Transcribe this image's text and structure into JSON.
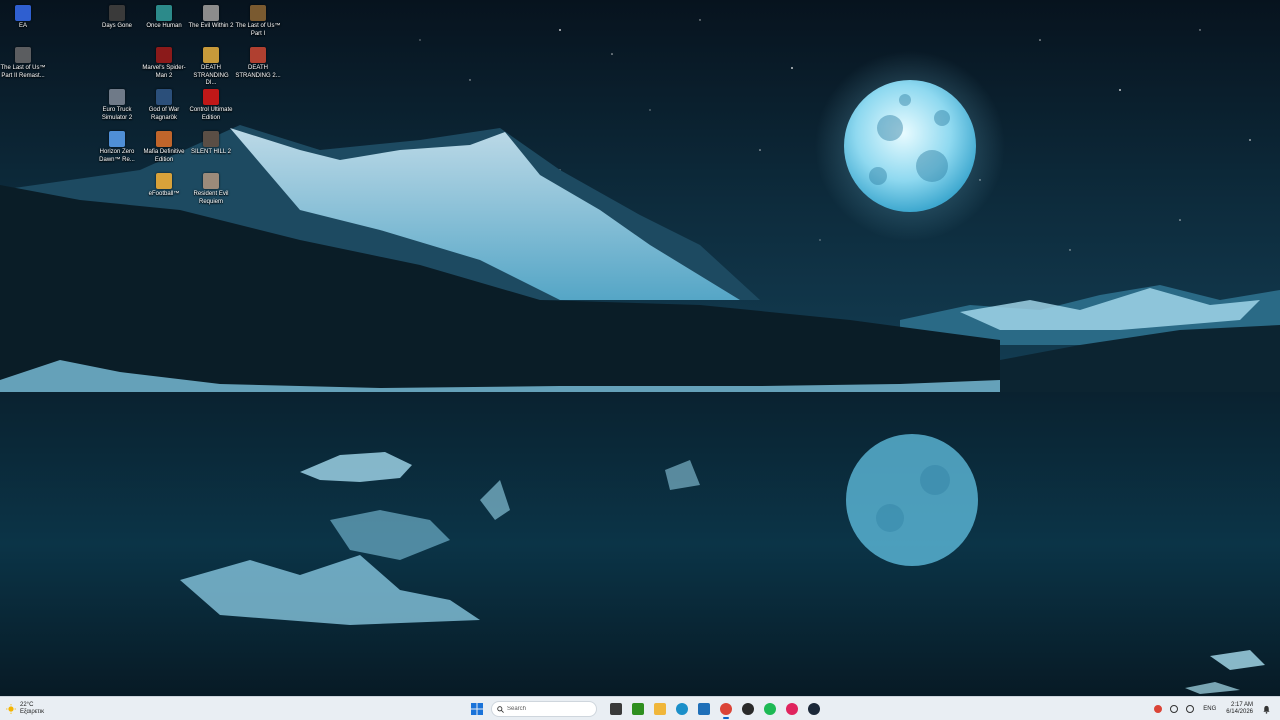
{
  "desktop": {
    "icons": [
      {
        "name": "desktop-icon-ea",
        "label": "EA",
        "icon": "ea-icon",
        "color": "#2f5fd0",
        "col": 0,
        "row": 0
      },
      {
        "name": "desktop-icon-last-of-us-2",
        "label": "The Last of Us™ Part II Remast...",
        "icon": "last-of-us-2-icon",
        "color": "#5b5d60",
        "col": 0,
        "row": 1
      },
      {
        "name": "desktop-icon-days-gone",
        "label": "Days Gone",
        "icon": "days-gone-icon",
        "color": "#3a3a3a",
        "col": 2,
        "row": 0
      },
      {
        "name": "desktop-icon-euro-truck",
        "label": "Euro Truck Simulator 2",
        "icon": "euro-truck-icon",
        "color": "#6f7a88",
        "col": 2,
        "row": 2
      },
      {
        "name": "desktop-icon-horizon-zero-dawn",
        "label": "Horizon Zero Dawn™ Re...",
        "icon": "horizon-zero-dawn-icon",
        "color": "#4f8fd6",
        "col": 2,
        "row": 3
      },
      {
        "name": "desktop-icon-once-human",
        "label": "Once Human",
        "icon": "once-human-icon",
        "color": "#2c8a8a",
        "col": 3,
        "row": 0
      },
      {
        "name": "desktop-icon-spider-man-2",
        "label": "Marvel's Spider-Man 2",
        "icon": "spider-man-icon",
        "color": "#8b1a1a",
        "col": 3,
        "row": 1
      },
      {
        "name": "desktop-icon-god-of-war",
        "label": "God of War Ragnarök",
        "icon": "god-of-war-icon",
        "color": "#2b4f7a",
        "col": 3,
        "row": 2
      },
      {
        "name": "desktop-icon-mafia",
        "label": "Mafia Definitive Edition",
        "icon": "mafia-icon",
        "color": "#c0652b",
        "col": 3,
        "row": 3
      },
      {
        "name": "desktop-icon-efootball",
        "label": "eFootball™",
        "icon": "efootball-icon",
        "color": "#d8a23a",
        "col": 3,
        "row": 4
      },
      {
        "name": "desktop-icon-evil-within-2",
        "label": "The Evil Within 2",
        "icon": "evil-within-icon",
        "color": "#8c8c8c",
        "col": 4,
        "row": 0
      },
      {
        "name": "desktop-icon-death-stranding-dc",
        "label": "DEATH STRANDING DI...",
        "icon": "death-stranding-icon",
        "color": "#c79a3a",
        "col": 4,
        "row": 1
      },
      {
        "name": "desktop-icon-control",
        "label": "Control Ultimate Edition",
        "icon": "control-icon",
        "color": "#c01818",
        "col": 4,
        "row": 2
      },
      {
        "name": "desktop-icon-silent-hill-2",
        "label": "SILENT HILL 2",
        "icon": "silent-hill-icon",
        "color": "#5a4e45",
        "col": 4,
        "row": 3
      },
      {
        "name": "desktop-icon-resident-evil",
        "label": "Resident Evil Requiem",
        "icon": "resident-evil-icon",
        "color": "#9c8b7a",
        "col": 4,
        "row": 4
      },
      {
        "name": "desktop-icon-last-of-us-1",
        "label": "The Last of Us™ Part I",
        "icon": "last-of-us-1-icon",
        "color": "#7a5a30",
        "col": 5,
        "row": 0
      },
      {
        "name": "desktop-icon-death-stranding-2",
        "label": "DEATH STRANDING 2...",
        "icon": "death-stranding-2-icon",
        "color": "#b04030",
        "col": 5,
        "row": 1
      }
    ]
  },
  "taskbar": {
    "weather": {
      "temp": "22°C",
      "condition": "Εξαιρετικ"
    },
    "search_placeholder": "Search",
    "apps": [
      {
        "name": "task-view-button",
        "icon": "task-view-icon",
        "color": "#3a3a3a"
      },
      {
        "name": "nvidia-button",
        "icon": "nvidia-icon",
        "color": "#2f8f1f"
      },
      {
        "name": "file-explorer-button",
        "icon": "folder-icon",
        "color": "#f0b63a"
      },
      {
        "name": "edge-button",
        "icon": "edge-icon",
        "color": "#1b8fc9"
      },
      {
        "name": "store-button",
        "icon": "store-icon",
        "color": "#1f6fb8"
      },
      {
        "name": "chrome-button",
        "icon": "chrome-icon",
        "color": "#db4437",
        "active": true
      },
      {
        "name": "obs-button",
        "icon": "obs-icon",
        "color": "#2a2a2a"
      },
      {
        "name": "spotify-button",
        "icon": "spotify-icon",
        "color": "#1db954"
      },
      {
        "name": "music-button",
        "icon": "music-icon",
        "color": "#e0245e"
      },
      {
        "name": "steam-button",
        "icon": "steam-icon",
        "color": "#1b2838"
      }
    ],
    "tray": {
      "tray_icons": [
        {
          "name": "tray-chrome",
          "icon": "chrome-tray-icon",
          "color": "#db4437"
        },
        {
          "name": "tray-network",
          "icon": "network-icon",
          "color": "#333333"
        },
        {
          "name": "tray-volume",
          "icon": "volume-icon",
          "color": "#333333"
        }
      ],
      "language": "ENG",
      "time": "2:17 AM",
      "date": "6/14/2026"
    }
  }
}
